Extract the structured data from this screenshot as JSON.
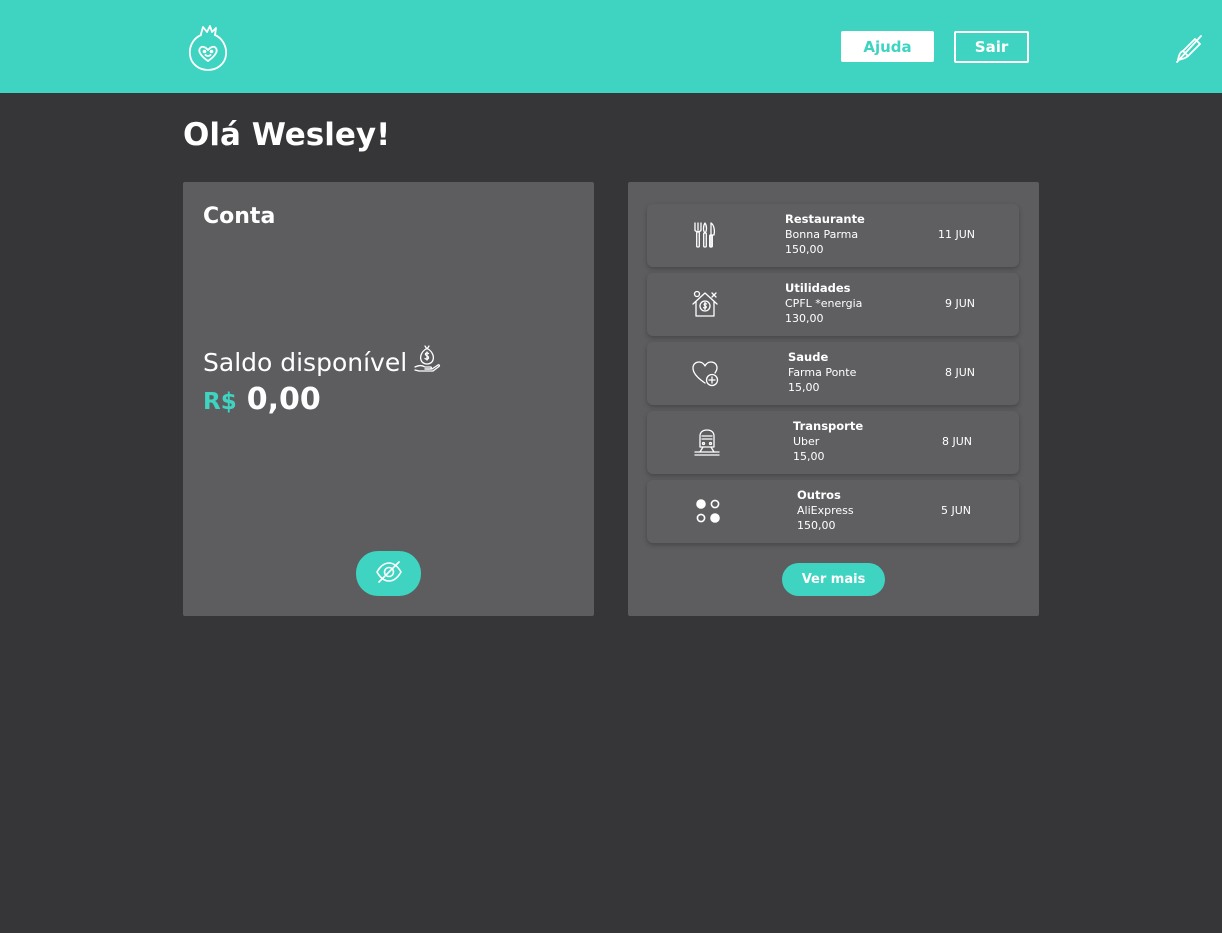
{
  "header": {
    "help_label": "Ajuda",
    "exit_label": "Sair",
    "logo_icon": "pomegranate-heart-logo-icon",
    "theme_icon": "crossed-brush-icon",
    "accent_color": "#3fd4c1"
  },
  "greeting": "Olá Wesley!",
  "account": {
    "title": "Conta",
    "balance_label": "Saldo disponível",
    "balance_icon": "money-bag-hand-icon",
    "currency": "R$",
    "amount": "0,00",
    "toggle_icon": "eye-off-icon"
  },
  "transactions": {
    "items": [
      {
        "category": "Restaurante",
        "merchant": "Bonna Parma",
        "value": "150,00",
        "date": "11 JUN",
        "icon": "cutlery-icon"
      },
      {
        "category": "Utilidades",
        "merchant": "CPFL *energia",
        "value": "130,00",
        "date": "9 JUN",
        "icon": "house-bills-icon"
      },
      {
        "category": "Saude",
        "merchant": "Farma Ponte",
        "value": "15,00",
        "date": "8 JUN",
        "icon": "heart-plus-icon"
      },
      {
        "category": "Transporte",
        "merchant": "Uber",
        "value": "15,00",
        "date": "8 JUN",
        "icon": "train-icon"
      },
      {
        "category": "Outros",
        "merchant": "AliExpress",
        "value": "150,00",
        "date": "5 JUN",
        "icon": "dots-grid-icon"
      }
    ],
    "more_label": "Ver mais"
  }
}
